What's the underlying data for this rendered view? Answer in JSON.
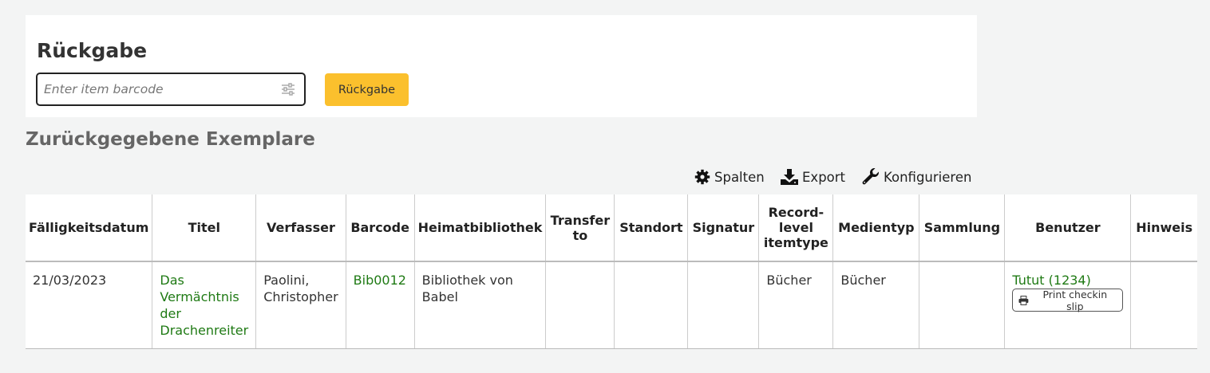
{
  "checkin": {
    "title": "Rückgabe",
    "barcode_placeholder": "Enter item barcode",
    "submit_label": "Rückgabe"
  },
  "returned": {
    "title": "Zurückgegebene Exemplare",
    "toolbar": {
      "columns_label": "Spalten",
      "export_label": "Export",
      "configure_label": "Konfigurieren"
    },
    "headers": [
      "Fälligkeitsdatum",
      "Titel",
      "Verfasser",
      "Barcode",
      "Heimatbibliothek",
      "Transfer to",
      "Standort",
      "Signatur",
      "Record-level itemtype",
      "Medientyp",
      "Sammlung",
      "Benutzer",
      "Hinweis"
    ],
    "rows": [
      {
        "due_date": "21/03/2023",
        "title": "Das Vermächtnis der Drachenreiter",
        "author": "Paolini, Christopher",
        "barcode": "Bib0012",
        "home_library": "Bibliothek von Babel",
        "transfer_to": "",
        "location": "",
        "call_number": "",
        "record_itemtype": "Bücher",
        "itemtype": "Bücher",
        "collection": "",
        "patron": "Tutut (1234)",
        "print_slip_label": "Print checkin slip",
        "note": ""
      }
    ]
  },
  "colors": {
    "primary_button": "#fbc02d",
    "link": "#1f7a14",
    "background": "#f3f4f4"
  }
}
